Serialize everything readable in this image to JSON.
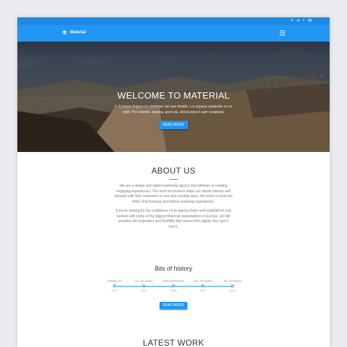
{
  "topbar": {
    "social": [
      "𝕏",
      "⊕",
      "f",
      "Bē"
    ]
  },
  "navbar": {
    "brand_name": "Material",
    "brand_icon": "layers-icon",
    "menu_icon": "hamburger-menu-icon"
  },
  "hero": {
    "title": "WELCOME TO MATERIAL",
    "subtitle": "Li Europan lingues es membres del sam familie. Lor separat existentie es un myth. Por scientie, musica, sport etc, litot Europa li sam vocabular.",
    "button_label": "READ MORE"
  },
  "about": {
    "title": "ABOUT US",
    "paragraph1": "We are a design and digital marketing agency that believes in creating engaging experiences. The work we produce helps our clients interact and transact with their customers in new and exciting ways. We strive to push the limits of technology and deliver amazing experiences.",
    "paragraph2": "If you're looking for the confidence of an agency that's well established, has worked with some of the biggest financial organisations in Europe, yet still provides the inspiration and flexibility that comes from agility, then get in touch."
  },
  "history": {
    "title": "Bits of history",
    "events": [
      {
        "label": "Starting out",
        "year": "1991"
      },
      {
        "label": "1st .net Award",
        "year": "2001"
      },
      {
        "label": "Hello Amsterdam",
        "year": "2009"
      },
      {
        "label": "2nd .net Award",
        "year": "2012"
      },
      {
        "label": "3rd .net Award",
        "year": "2013"
      }
    ],
    "button_label": "READ MORE"
  },
  "work": {
    "title": "LATEST WORK"
  },
  "colors": {
    "primary": "#2196f3",
    "topbar": "#1e88e5"
  }
}
